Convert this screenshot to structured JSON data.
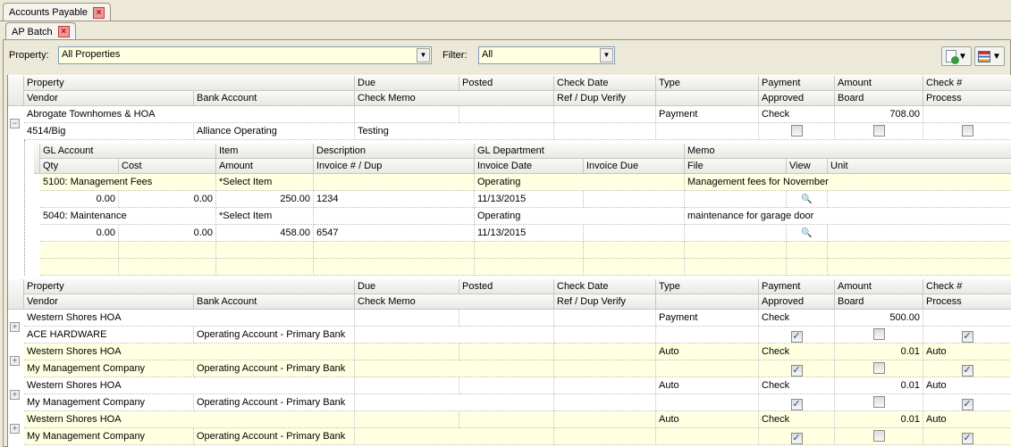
{
  "tabs": {
    "outer": "Accounts Payable",
    "inner": "AP Batch"
  },
  "filters": {
    "property_label": "Property:",
    "property_value": "All Properties",
    "filter_label": "Filter:",
    "filter_value": "All"
  },
  "toolbar": {
    "icons": [
      "document-check-icon",
      "layout-grid-icon"
    ]
  },
  "main_header": {
    "row1": [
      "Property",
      "Due",
      "Posted",
      "Check Date",
      "Type",
      "Payment",
      "Amount",
      "Check #"
    ],
    "row2": [
      "Vendor",
      "Bank Account",
      "Check Memo",
      "Ref / Dup Verify",
      "",
      "Approved",
      "Board",
      "Process"
    ]
  },
  "sub_header": {
    "row1": [
      "GL Account",
      "Item",
      "Description",
      "GL Department",
      "Memo"
    ],
    "row2": [
      "Qty",
      "Cost",
      "Amount",
      "Invoice # / Dup",
      "Invoice Date",
      "Invoice Due",
      "File",
      "View",
      "Unit"
    ]
  },
  "batch1": {
    "property": "Abrogate Townhomes & HOA",
    "type": "Payment",
    "payment": "Check",
    "amount": "708.00",
    "vendor": "4514/Big",
    "bank": "Alliance Operating",
    "check_memo": "Testing",
    "approved": false,
    "board": false,
    "process": false,
    "lines": [
      {
        "gl_account": "5100: Management Fees",
        "item": "*Select Item",
        "gl_department": "Operating",
        "memo": "Management fees for November",
        "qty": "0.00",
        "cost": "0.00",
        "amount": "250.00",
        "invoice": "1234",
        "invoice_date": "11/13/2015",
        "view_icon": "magnifier-icon"
      },
      {
        "gl_account": "5040: Maintenance",
        "item": "*Select Item",
        "gl_department": "Operating",
        "memo": "maintenance for garage door",
        "qty": "0.00",
        "cost": "0.00",
        "amount": "458.00",
        "invoice": "6547",
        "invoice_date": "11/13/2015",
        "view_icon": "magnifier-icon"
      }
    ]
  },
  "batches": [
    {
      "property": "Western Shores HOA",
      "type": "Payment",
      "payment": "Check",
      "amount": "500.00",
      "check_no": "",
      "vendor": "ACE HARDWARE",
      "bank": "Operating Account - Primary Bank",
      "approved": true,
      "board": false,
      "process": true
    },
    {
      "property": "Western Shores HOA",
      "type": "Auto",
      "payment": "Check",
      "amount": "0.01",
      "check_no": "Auto",
      "vendor": "My Management Company",
      "bank": "Operating Account - Primary Bank",
      "approved": true,
      "board": false,
      "process": true
    },
    {
      "property": "Western Shores HOA",
      "type": "Auto",
      "payment": "Check",
      "amount": "0.01",
      "check_no": "Auto",
      "vendor": "My Management Company",
      "bank": "Operating Account - Primary Bank",
      "approved": true,
      "board": false,
      "process": true
    },
    {
      "property": "Western Shores HOA",
      "type": "Auto",
      "payment": "Check",
      "amount": "0.01",
      "check_no": "Auto",
      "vendor": "My Management Company",
      "bank": "Operating Account - Primary Bank",
      "approved": true,
      "board": false,
      "process": true
    }
  ]
}
